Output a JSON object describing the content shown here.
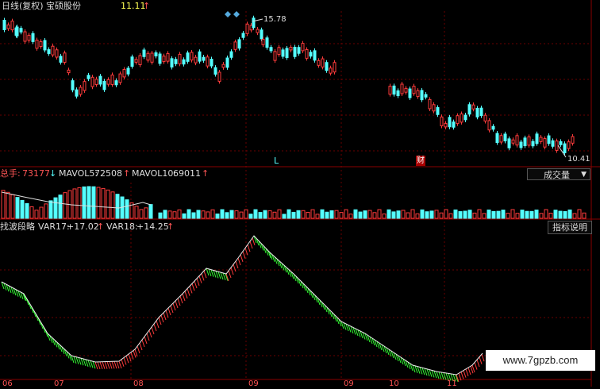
{
  "header": {
    "period_label": "日线(复权)",
    "stock_name": "宝硕股份",
    "last_price": "11.11",
    "up_arrow": "↑"
  },
  "price_panel": {
    "high_marker": "15.78",
    "low_marker": "10.41",
    "event_marker_l": "L",
    "event_marker_cai": "财"
  },
  "volume_panel": {
    "total_label": "总手:",
    "total_value": "73177",
    "total_arrow": "↓",
    "mavol5_label": "MAVOL5:",
    "mavol5_value": "72508",
    "mavol5_arrow": "↑",
    "mavol10_label": "MAVOL10:",
    "mavol10_value": "69011",
    "mavol10_arrow": "↑",
    "indicator_select": "成交量",
    "dropdown_icon": "triangle-down-icon"
  },
  "indicator_panel": {
    "name": "找波段略",
    "var17_label": "VAR17:",
    "var17_value": "+17.02",
    "var17_arrow": "↑",
    "var18_label": "VAR18:",
    "var18_value": "+14.25",
    "var18_arrow": "↑",
    "help_button": "指标说明"
  },
  "x_axis_labels": [
    "06",
    "07",
    "08",
    "09",
    "09",
    "10",
    "11"
  ],
  "watermark": "www.7gpzb.com",
  "colors": {
    "up": "#ff3b3b",
    "down": "#54ffff",
    "grid": "#7a0000",
    "text_red": "#ff5555",
    "text_cyan": "#54ffff",
    "text_yellow": "#ffff54"
  }
}
